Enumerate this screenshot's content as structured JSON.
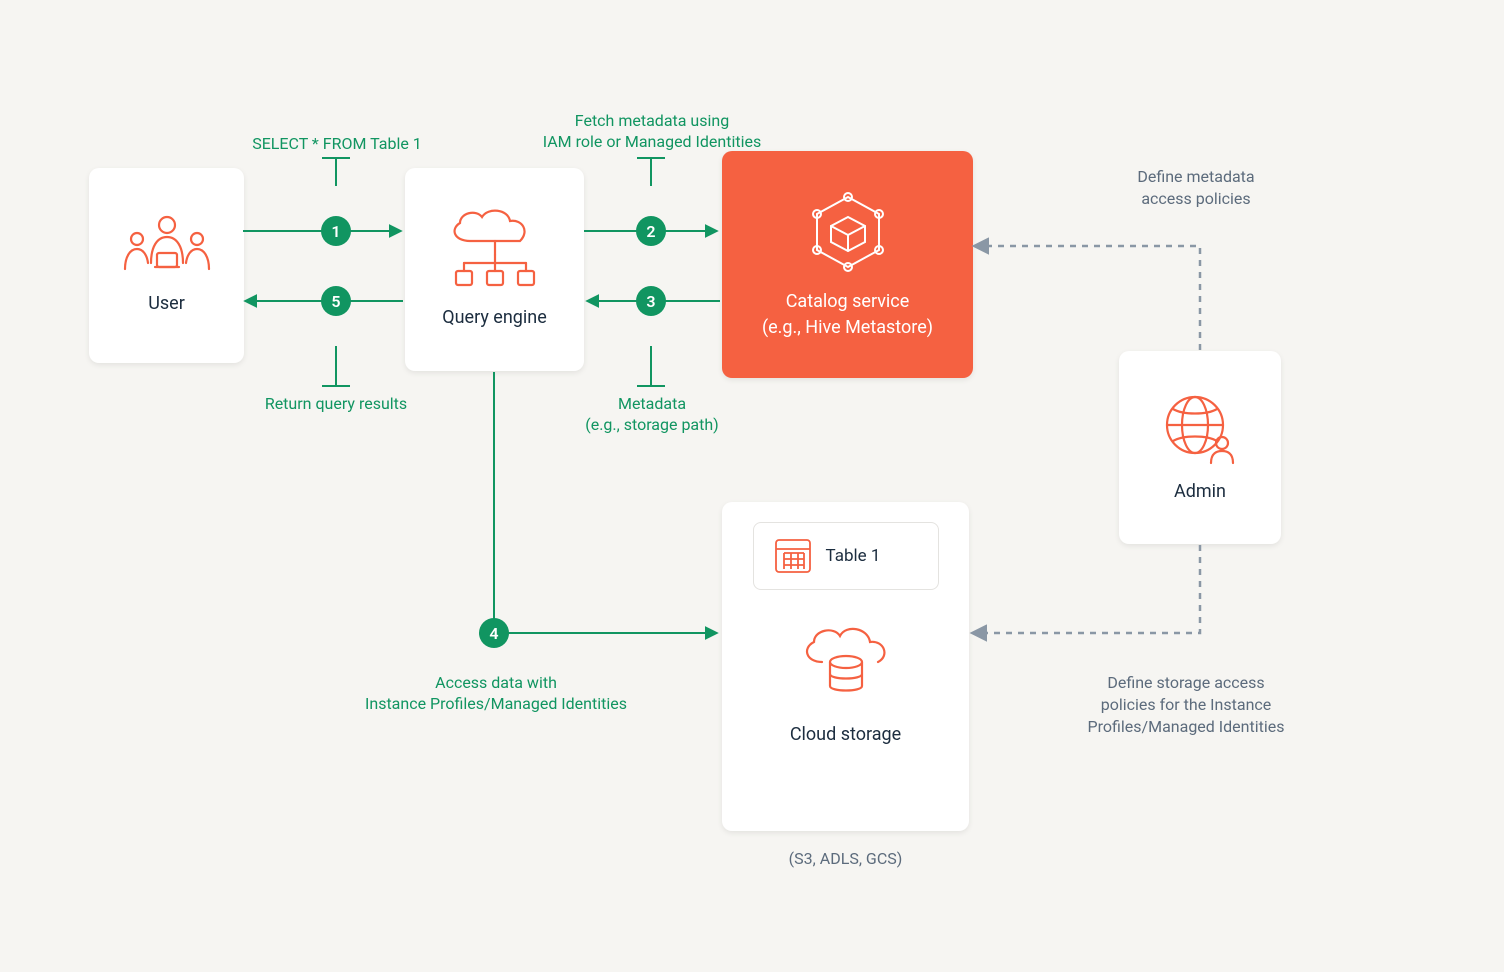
{
  "nodes": {
    "user": {
      "label": "User"
    },
    "queryEngine": {
      "label": "Query engine"
    },
    "catalog": {
      "label": "Catalog service\n(e.g., Hive Metastore)"
    },
    "cloudStorage": {
      "label": "Cloud storage",
      "sublabel": "(S3, ADLS, GCS)"
    },
    "admin": {
      "label": "Admin"
    },
    "table": {
      "label": "Table 1"
    }
  },
  "steps": {
    "s1": "1",
    "s2": "2",
    "s3": "3",
    "s4": "4",
    "s5": "5"
  },
  "labels": {
    "step1": "SELECT * FROM Table 1",
    "step2a": "Fetch metadata using",
    "step2b": "IAM role or Managed Identities",
    "step3a": "Metadata",
    "step3b": "(e.g., storage path)",
    "step4a": "Access data with",
    "step4b": "Instance Profiles/Managed Identities",
    "step5": "Return query results",
    "adminMeta1": "Define metadata",
    "adminMeta2": "access policies",
    "adminStorage1": "Define storage access",
    "adminStorage2": "policies for the Instance",
    "adminStorage3": "Profiles/Managed Identities"
  }
}
